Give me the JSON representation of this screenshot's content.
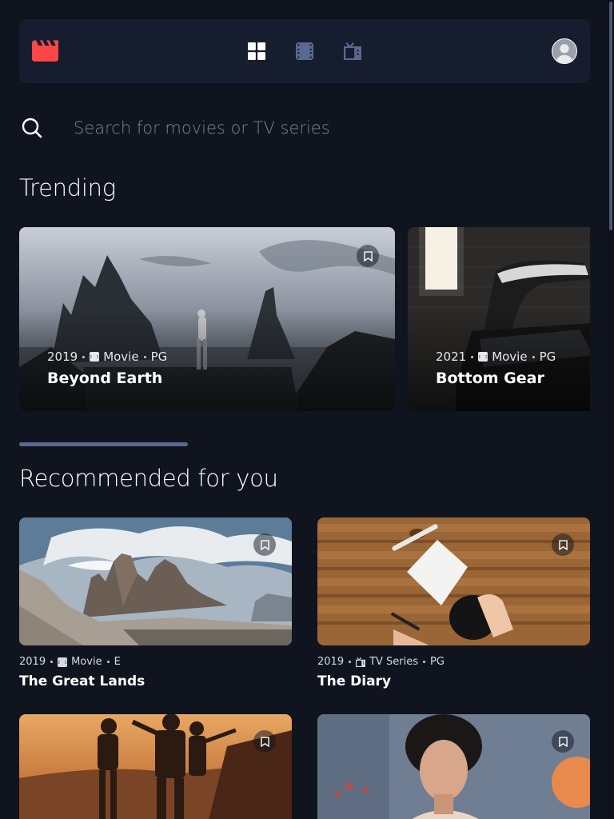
{
  "nav": {
    "logo_icon": "clapperboard-logo-icon",
    "items": [
      {
        "icon": "grid-home-icon",
        "active": true
      },
      {
        "icon": "film-movies-icon",
        "active": false
      },
      {
        "icon": "tv-series-icon",
        "active": false
      }
    ],
    "avatar_icon": "user-avatar-icon"
  },
  "search": {
    "placeholder": "Search for movies or TV series"
  },
  "sections": {
    "trending_title": "Trending",
    "recommended_title": "Recommended for you"
  },
  "trending": [
    {
      "year": "2019",
      "category": "Movie",
      "rating": "PG",
      "title": "Beyond Earth",
      "bookmark_icon": "bookmark-icon"
    },
    {
      "year": "2021",
      "category": "Movie",
      "rating": "PG",
      "title": "Bottom Gear",
      "bookmark_icon": "bookmark-icon"
    }
  ],
  "recommended": [
    {
      "year": "2019",
      "category": "Movie",
      "rating": "E",
      "title": "The Great Lands"
    },
    {
      "year": "2019",
      "category": "TV Series",
      "rating": "PG",
      "title": "The Diary"
    },
    {
      "year": "",
      "category": "",
      "rating": "",
      "title": ""
    },
    {
      "year": "",
      "category": "",
      "rating": "",
      "title": ""
    }
  ],
  "colors": {
    "background": "#10141e",
    "surface": "#161d2f",
    "accent_red": "#fc4747",
    "muted": "#5a698f",
    "text": "#ffffff"
  }
}
